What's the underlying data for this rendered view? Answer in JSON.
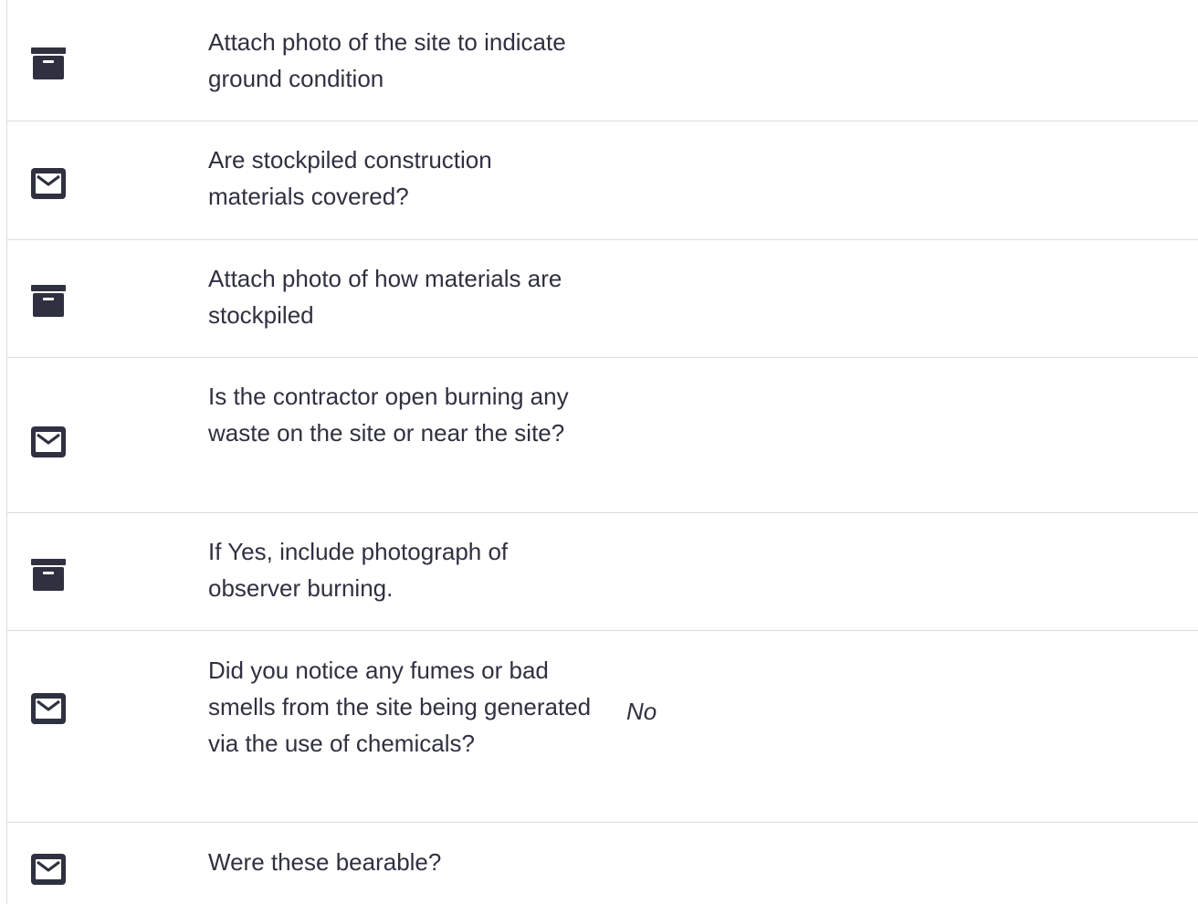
{
  "colors": {
    "icon": "#2f3140",
    "text": "#2f3140",
    "divider": "#dcdde2",
    "background": "#ffffff"
  },
  "rows": [
    {
      "icon": "archive-icon",
      "question": "Attach photo of the site to indicate ground condition",
      "answer": ""
    },
    {
      "icon": "envelope-icon",
      "question": "Are stockpiled construction materials covered?",
      "answer": ""
    },
    {
      "icon": "archive-icon",
      "question": "Attach photo of how materials are stockpiled",
      "answer": ""
    },
    {
      "icon": "envelope-icon",
      "question": "Is the contractor open burning any waste on the site or near the site?",
      "answer": ""
    },
    {
      "icon": "archive-icon",
      "question": "If Yes, include photograph of observer burning.",
      "answer": ""
    },
    {
      "icon": "envelope-icon",
      "question": "Did you notice any fumes or bad smells from the site being generated via the use of chemicals?",
      "answer": "No"
    },
    {
      "icon": "envelope-icon",
      "question": "Were these bearable?",
      "answer": ""
    }
  ]
}
